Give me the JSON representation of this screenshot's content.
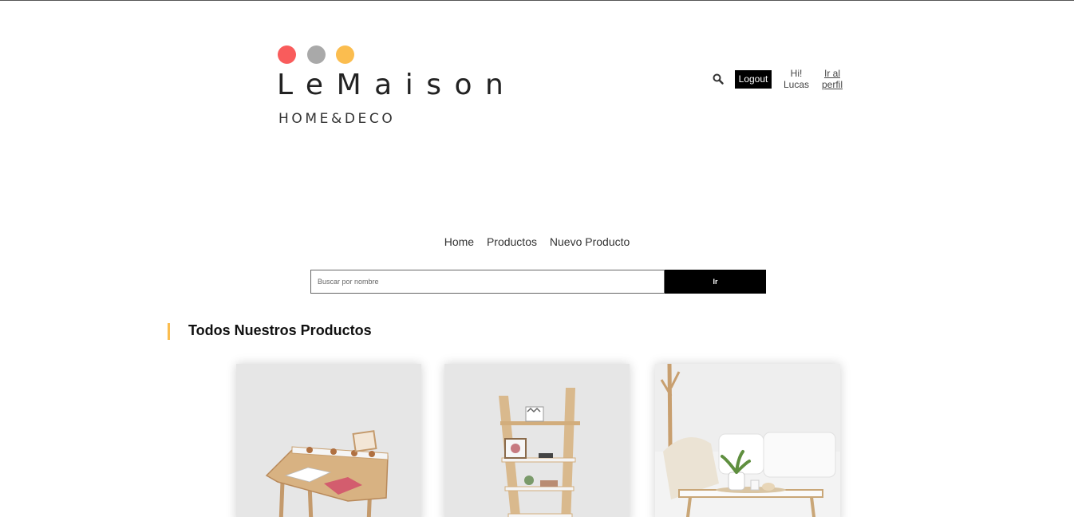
{
  "colors": {
    "dot_red": "#f95c5c",
    "dot_gray": "#a9a9a9",
    "dot_yellow": "#fbbd4f",
    "accent": "#fbbd4f",
    "button_bg": "#000000"
  },
  "header": {
    "brand": "LeMaison",
    "tagline": "HOME&DECO",
    "logout_label": "Logout",
    "greeting_line1": "Hi!",
    "greeting_line2": "Lucas",
    "profile_line1": "Ir al",
    "profile_line2": "perfil",
    "search_icon": "search-icon"
  },
  "nav": {
    "items": [
      "Home",
      "Productos",
      "Nuevo Producto"
    ]
  },
  "search": {
    "placeholder": "Buscar por nombre",
    "value": "",
    "submit_label": "Ir"
  },
  "main": {
    "section_title": "Todos Nuestros Productos",
    "products": [
      {
        "image": "desk-product-image"
      },
      {
        "image": "ladder-shelf-product-image"
      },
      {
        "image": "coffee-table-product-image"
      }
    ]
  }
}
